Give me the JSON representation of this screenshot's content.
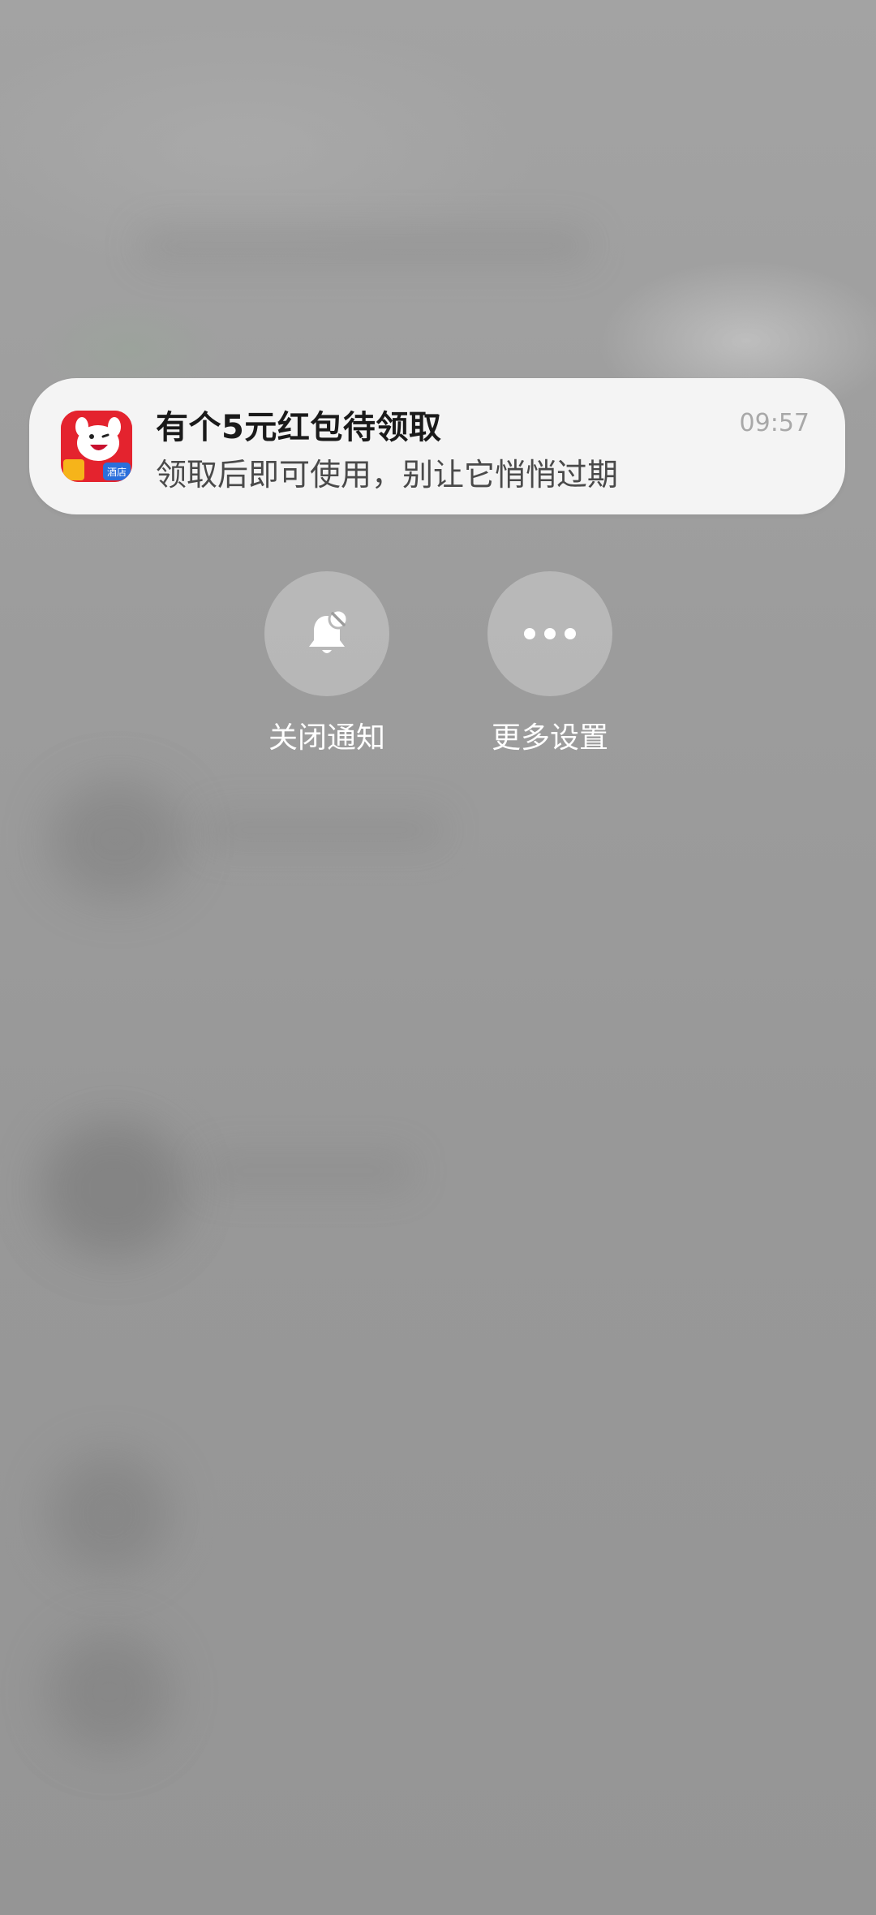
{
  "notification": {
    "app_icon": "red-dog-hotel-app-icon",
    "icon_badge": "酒店",
    "title": "有个5元红包待领取",
    "body": "领取后即可使用，别让它悄悄过期",
    "time": "09:57"
  },
  "actions": [
    {
      "label": "关闭通知",
      "icon": "bell-off-icon"
    },
    {
      "label": "更多设置",
      "icon": "more-icon"
    }
  ],
  "colors": {
    "card_background": "#f4f4f4",
    "app_icon_red": "#e4232e",
    "action_label": "#ffffff"
  }
}
